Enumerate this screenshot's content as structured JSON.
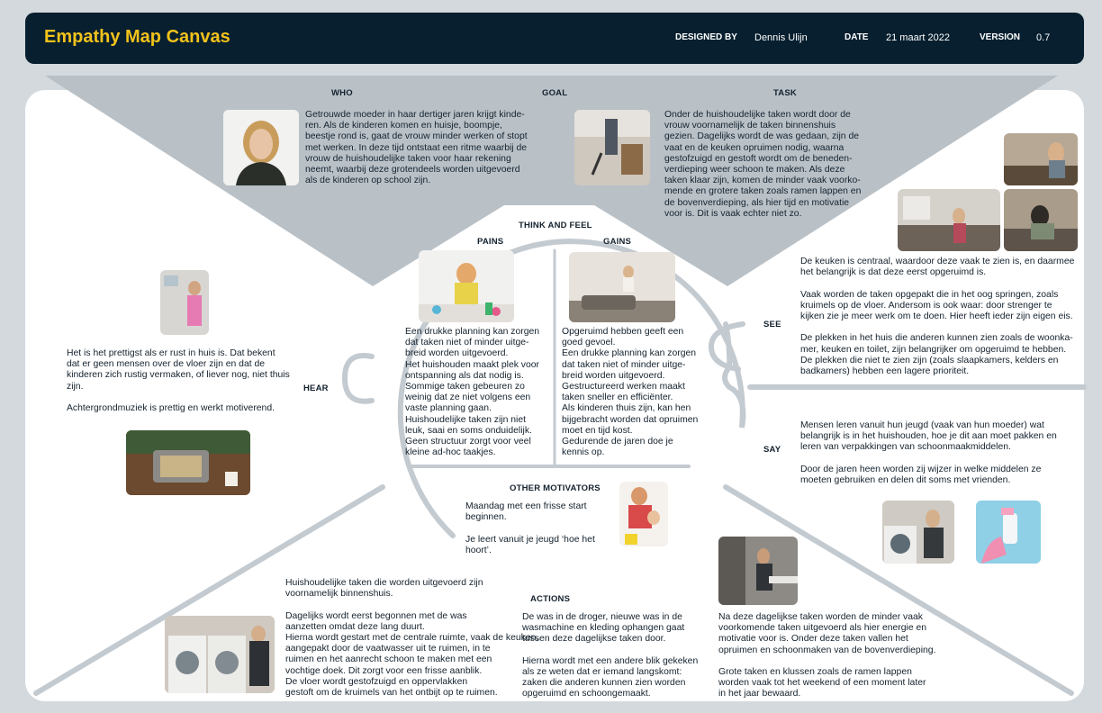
{
  "header": {
    "title": "Empathy Map Canvas",
    "designed_by_label": "DESIGNED BY",
    "designed_by_value": "Dennis Ulijn",
    "date_label": "DATE",
    "date_value": "21 maart 2022",
    "version_label": "VERSION",
    "version_value": "0.7"
  },
  "top": {
    "who_label": "WHO",
    "goal_label": "GOAL",
    "task_label": "TASK",
    "who_text": "Getrouwde moeder in haar dertiger jaren krijgt kinde-\nren. Als de kinderen komen en huisje, boompje,\nbeestje rond is, gaat de vrouw minder werken of stopt\nmet werken. In deze tijd ontstaat een ritme waarbij de\nvrouw de huishoudelijke taken voor haar rekening\nneemt, waarbij deze grotendeels worden uitgevoerd\nals de kinderen op school zijn.",
    "task_text": "Onder de huishoudelijke taken wordt door de\nvrouw voornamelijk de taken binnenshuis\ngezien. Dagelijks wordt de was gedaan, zijn de\nvaat en de keuken opruimen nodig, waarna\ngestofzuigd en gestoft wordt om de beneden-\nverdieping weer schoon te maken. Als deze\ntaken klaar zijn, komen de minder vaak voorko-\nmende en grotere taken zoals ramen lappen en\nde bovenverdieping, als hier tijd en motivatie\nvoor is. Dit is vaak echter niet zo."
  },
  "think": {
    "title": "THINK AND FEEL",
    "pains_label": "PAINS",
    "gains_label": "GAINS",
    "pains_text": "Een drukke planning kan zorgen\ndat taken niet of minder uitge-\nbreid worden uitgevoerd.\nHet huishouden maakt plek voor\nontspanning als dat nodig is.\nSommige taken gebeuren zo\nweinig dat ze niet volgens een\nvaste planning gaan.\nHuishoudelijke taken zijn niet\nleuk, saai en soms onduidelijk.\nGeen structuur zorgt voor veel\nkleine ad-hoc taakjes.",
    "gains_text": "Opgeruimd hebben geeft een\ngoed gevoel.\nEen drukke planning kan zorgen\ndat taken niet of minder uitge-\nbreid worden uitgevoerd.\nGestructureerd werken maakt\ntaken sneller en efficiënter.\nAls kinderen thuis zijn, kan hen\nbijgebracht worden dat opruimen\nmoet en tijd kost.\nGedurende de jaren doe je\nkennis op.",
    "motivators_label": "OTHER MOTIVATORS",
    "motivators_text": "Maandag met een frisse start\nbeginnen.\n\nJe leert vanuit je jeugd ‘hoe het\nhoort’."
  },
  "hear": {
    "label": "HEAR",
    "text": "Het is het prettigst als er rust in huis is. Dat bekent\ndat er geen mensen over de vloer zijn en dat de\nkinderen zich rustig vermaken, of liever nog, niet thuis\nzijn.\n\nAchtergrondmuziek is prettig en werkt motiverend."
  },
  "see": {
    "label": "SEE",
    "text": "De keuken is centraal, waardoor deze vaak te zien is, en daarmee\nhet belangrijk is dat deze eerst opgeruimd is.\n\nVaak worden de taken opgepakt die in het oog springen, zoals\nkruimels op de vloer. Andersom is ook waar: door strenger te\nkijken zie je meer werk om te doen. Hier heeft ieder zijn eigen eis.\n\nDe plekken in het huis die anderen kunnen zien zoals de woonka-\nmer, keuken en toilet, zijn belangrijker om opgeruimd te hebben.\nDe plekken die niet te zien zijn (zoals slaapkamers, kelders en\nbadkamers) hebben een lagere prioriteit."
  },
  "say": {
    "label": "SAY",
    "text": "Mensen leren vanuit hun jeugd (vaak van hun moeder) wat\nbelangrijk is in het huishouden, hoe je dit aan moet pakken en\nleren van verpakkingen van schoonmaakmiddelen.\n\nDoor de jaren heen worden zij wijzer in welke middelen ze\nmoeten gebruiken en delen dit soms met vrienden."
  },
  "actions": {
    "label": "ACTIONS",
    "left_text": "Huishoudelijke taken die worden uitgevoerd zijn\nvoornamelijk binnenshuis.\n\nDagelijks wordt eerst begonnen met de was\naanzetten omdat deze lang duurt.\nHierna wordt gestart met de centrale ruimte, vaak de keuken,\naangepakt door de vaatwasser uit te ruimen, in te\nruimen en het aanrecht schoon te maken met een\nvochtige doek. Dit zorgt voor een frisse aanblik.\nDe vloer wordt gestofzuigd en oppervlakken\ngestoft om de kruimels van het ontbijt op te ruimen.",
    "center_text": "De was in de droger, nieuwe was in de\nwasmachine en kleding ophangen gaat\ntussen deze dagelijkse taken door.\n\nHierna wordt met een andere blik gekeken\nals ze weten dat er iemand langskomt:\nzaken die anderen kunnen zien worden\nopgeruimd en schoongemaakt.",
    "right_text": "Na deze dagelijkse taken worden de minder vaak\nvoorkomende taken uitgevoerd als hier energie en\nmotivatie voor is. Onder deze taken vallen het\nopruimen en schoonmaken van de bovenverdieping.\n\nGrote taken en klussen zoals de ramen lappen\nworden vaak tot het weekend of een moment later\nin het jaar bewaard."
  },
  "colors": {
    "header_bg": "#071f2f",
    "title_accent": "#f2c21b",
    "canvas_bg": "#ffffff",
    "goal_band": "#b9c1c7",
    "line": "#c3cad0",
    "page_bg": "#d3d9dd"
  }
}
